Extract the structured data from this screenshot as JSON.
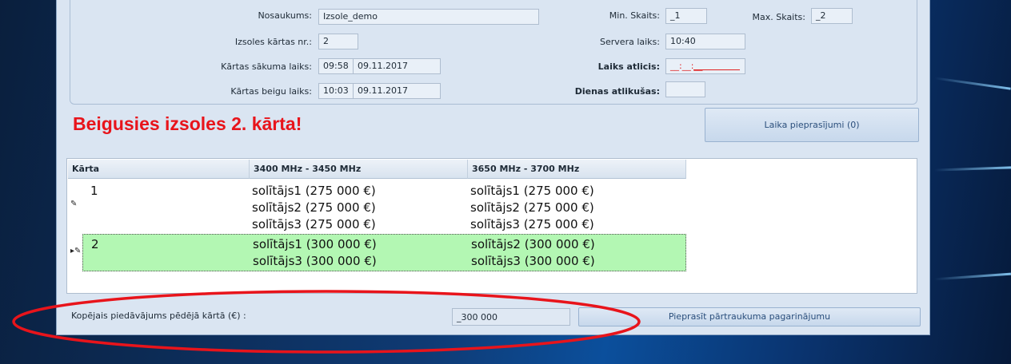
{
  "form": {
    "name_label": "Nosaukums:",
    "name_value": "Izsole_demo",
    "round_no_label": "Izsoles kārtas nr.:",
    "round_no_value": "2",
    "round_start_label": "Kārtas sākuma laiks:",
    "round_start_time": "09:58",
    "round_start_date": "09.11.2017",
    "round_end_label": "Kārtas beigu laiks:",
    "round_end_time": "10:03",
    "round_end_date": "09.11.2017",
    "min_count_label": "Min. Skaits:",
    "min_count_value": "_1",
    "max_count_label": "Max. Skaits:",
    "max_count_value": "_2",
    "server_time_label": "Servera laiks:",
    "server_time_value": "10:40",
    "time_left_label": "Laiks atlicis:",
    "time_left_value": "__:__:__",
    "days_left_label": "Dienas atlikušas:",
    "days_left_value": ""
  },
  "status_message": "Beigusies izsoles 2. kārta!",
  "buttons": {
    "time_requests": "Laika pieprasījumi (0)",
    "request_extension": "Pieprasīt pārtraukuma pagarinājumu"
  },
  "grid": {
    "headers": [
      "Kārta",
      "3400 MHz - 3450 MHz",
      "3650 MHz - 3700 MHz"
    ],
    "rows": [
      {
        "round": "1",
        "col1": [
          "solītājs1 (275 000 €)",
          "solītājs2 (275 000 €)",
          "solītājs3 (275 000 €)"
        ],
        "col2": [
          "solītājs1 (275 000 €)",
          "solītājs2 (275 000 €)",
          "solītājs3 (275 000 €)"
        ]
      },
      {
        "round": "2",
        "col1": [
          "solītājs1 (300 000 €)",
          "solītājs3 (300 000 €)"
        ],
        "col2": [
          "solītājs2 (300 000 €)",
          "solītājs3 (300 000 €)"
        ]
      }
    ]
  },
  "total": {
    "label": "Kopējais piedāvājums pēdējā kārtā (€) :",
    "value": "_300 000"
  },
  "colors": {
    "status_red": "#e8141b",
    "selected_row": "#b3f7b3",
    "window_bg": "#dae5f2",
    "annotation_oval": "#e8141b"
  },
  "icons": {
    "row_edit": "pencil-icon",
    "row_current": "current-row-arrow-icon"
  }
}
